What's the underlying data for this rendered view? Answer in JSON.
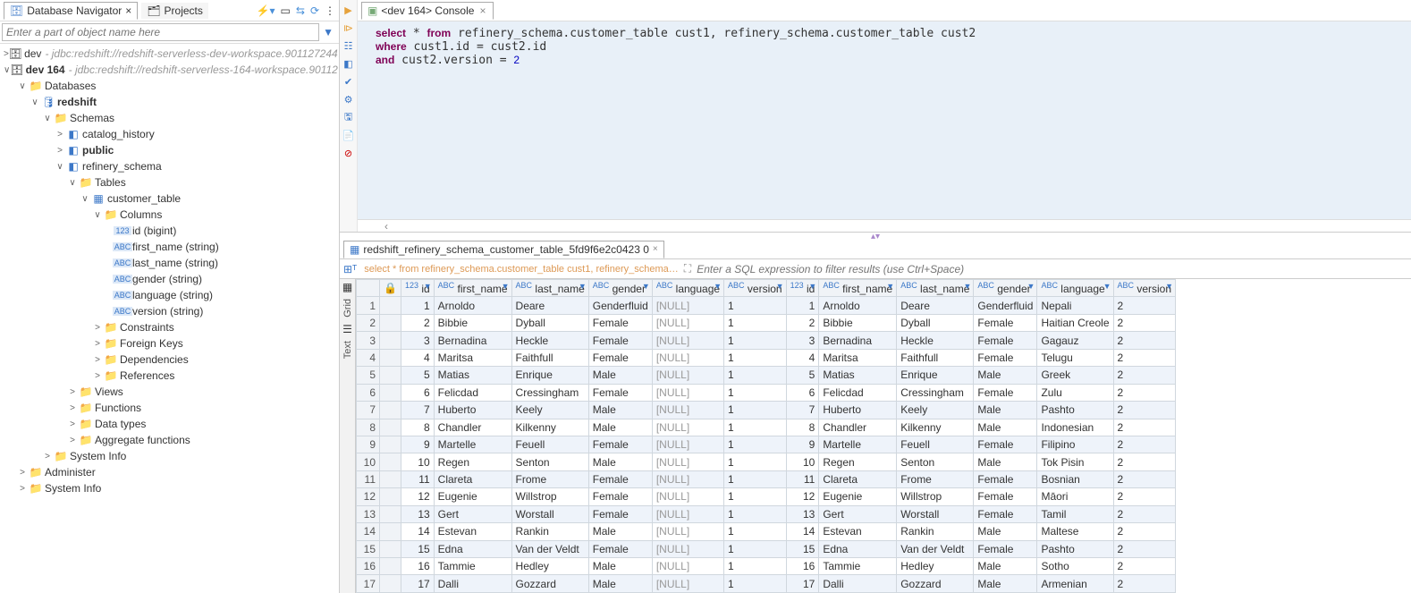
{
  "nav": {
    "tab1": "Database Navigator",
    "tab2": "Projects",
    "filter_placeholder": "Enter a part of object name here",
    "tree": [
      {
        "ind": 0,
        "tw": ">",
        "icon": "🗄",
        "lbl": "dev",
        "desc": " - jdbc:redshift://redshift-serverless-dev-workspace.901127244…",
        "name": "conn-dev"
      },
      {
        "ind": 0,
        "tw": "∨",
        "icon": "🗄",
        "lbl": "dev 164",
        "desc": " - jdbc:redshift://redshift-serverless-164-workspace.901127…",
        "bold": true,
        "name": "conn-dev164"
      },
      {
        "ind": 1,
        "tw": "∨",
        "icon": "📁",
        "cls": "i-folder",
        "lbl": "Databases",
        "name": "node-databases"
      },
      {
        "ind": 2,
        "tw": "∨",
        "icon": "🛢",
        "cls": "i-db",
        "lbl": "redshift",
        "bold": true,
        "name": "node-db-redshift"
      },
      {
        "ind": 3,
        "tw": "∨",
        "icon": "📁",
        "cls": "i-folder",
        "lbl": "Schemas",
        "name": "node-schemas"
      },
      {
        "ind": 4,
        "tw": ">",
        "icon": "◧",
        "cls": "i-schema",
        "lbl": "catalog_history",
        "name": "schema-catalog-history"
      },
      {
        "ind": 4,
        "tw": ">",
        "icon": "◧",
        "cls": "i-schema",
        "lbl": "public",
        "bold": true,
        "name": "schema-public"
      },
      {
        "ind": 4,
        "tw": "∨",
        "icon": "◧",
        "cls": "i-schema",
        "lbl": "refinery_schema",
        "name": "schema-refinery"
      },
      {
        "ind": 5,
        "tw": "∨",
        "icon": "📁",
        "cls": "i-folder",
        "lbl": "Tables",
        "name": "node-tables"
      },
      {
        "ind": 6,
        "tw": "∨",
        "icon": "▦",
        "cls": "i-table",
        "lbl": "customer_table",
        "name": "table-customer"
      },
      {
        "ind": 7,
        "tw": "∨",
        "icon": "📁",
        "cls": "i-folder",
        "lbl": "Columns",
        "name": "node-columns"
      },
      {
        "ind": 7,
        "tw": "",
        "icon": "▪",
        "cls": "i-col",
        "lbl": "id (bigint)",
        "pad": 1,
        "name": "col-id",
        "tp": "123"
      },
      {
        "ind": 7,
        "tw": "",
        "icon": "▪",
        "cls": "i-col",
        "lbl": "first_name (string)",
        "pad": 1,
        "name": "col-first-name",
        "tp": "ABC"
      },
      {
        "ind": 7,
        "tw": "",
        "icon": "▪",
        "cls": "i-col",
        "lbl": "last_name (string)",
        "pad": 1,
        "name": "col-last-name",
        "tp": "ABC"
      },
      {
        "ind": 7,
        "tw": "",
        "icon": "▪",
        "cls": "i-col",
        "lbl": "gender (string)",
        "pad": 1,
        "name": "col-gender",
        "tp": "ABC"
      },
      {
        "ind": 7,
        "tw": "",
        "icon": "▪",
        "cls": "i-col",
        "lbl": "language (string)",
        "pad": 1,
        "name": "col-language",
        "tp": "ABC"
      },
      {
        "ind": 7,
        "tw": "",
        "icon": "▪",
        "cls": "i-col",
        "lbl": "version (string)",
        "pad": 1,
        "name": "col-version",
        "tp": "ABC"
      },
      {
        "ind": 7,
        "tw": ">",
        "icon": "📁",
        "cls": "i-folder",
        "lbl": "Constraints",
        "name": "node-constraints"
      },
      {
        "ind": 7,
        "tw": ">",
        "icon": "📁",
        "cls": "i-folder",
        "lbl": "Foreign Keys",
        "name": "node-fks"
      },
      {
        "ind": 7,
        "tw": ">",
        "icon": "📁",
        "cls": "i-folder",
        "lbl": "Dependencies",
        "name": "node-deps"
      },
      {
        "ind": 7,
        "tw": ">",
        "icon": "📁",
        "cls": "i-folder",
        "lbl": "References",
        "name": "node-refs"
      },
      {
        "ind": 5,
        "tw": ">",
        "icon": "📁",
        "cls": "i-folder",
        "lbl": "Views",
        "name": "node-views"
      },
      {
        "ind": 5,
        "tw": ">",
        "icon": "📁",
        "cls": "i-folder",
        "lbl": "Functions",
        "name": "node-functions"
      },
      {
        "ind": 5,
        "tw": ">",
        "icon": "📁",
        "cls": "i-folder",
        "lbl": "Data types",
        "name": "node-datatypes"
      },
      {
        "ind": 5,
        "tw": ">",
        "icon": "📁",
        "cls": "i-folder",
        "lbl": "Aggregate functions",
        "name": "node-aggfunc"
      },
      {
        "ind": 3,
        "tw": ">",
        "icon": "📁",
        "cls": "i-folder",
        "lbl": "System Info",
        "name": "node-sysinfo1"
      },
      {
        "ind": 1,
        "tw": ">",
        "icon": "📁",
        "cls": "i-folder",
        "lbl": "Administer",
        "name": "node-administer"
      },
      {
        "ind": 1,
        "tw": ">",
        "icon": "📁",
        "cls": "i-folder",
        "lbl": "System Info",
        "name": "node-sysinfo2"
      }
    ]
  },
  "editor": {
    "tab": "<dev 164> Console",
    "sql_html": "<span class='kw'>select</span> * <span class='kw'>from</span> refinery_schema.customer_table cust1, refinery_schema.customer_table cust2\n<span class='kw'>where</span> cust1.id = cust2.id\n<span class='kw'>and</span> cust2.version = <span class='num'>2</span>"
  },
  "results": {
    "tab": "redshift_refinery_schema_customer_table_5fd9f6e2c0423 0",
    "sqlpreview": "select * from refinery_schema.customer_table cust1, refinery_schema…",
    "filter_placeholder": "Enter a SQL expression to filter results (use Ctrl+Space)",
    "side": {
      "grid": "Grid",
      "text": "Text"
    },
    "cols": [
      {
        "t": "123",
        "l": "id"
      },
      {
        "t": "ABC",
        "l": "first_name"
      },
      {
        "t": "ABC",
        "l": "last_name"
      },
      {
        "t": "ABC",
        "l": "gender"
      },
      {
        "t": "ABC",
        "l": "language"
      },
      {
        "t": "ABC",
        "l": "version"
      },
      {
        "t": "123",
        "l": "id"
      },
      {
        "t": "ABC",
        "l": "first_name"
      },
      {
        "t": "ABC",
        "l": "last_name"
      },
      {
        "t": "ABC",
        "l": "gender"
      },
      {
        "t": "ABC",
        "l": "language"
      },
      {
        "t": "ABC",
        "l": "version"
      }
    ],
    "rows": [
      [
        1,
        "Arnoldo",
        "Deare",
        "Genderfluid",
        "[NULL]",
        "1",
        1,
        "Arnoldo",
        "Deare",
        "Genderfluid",
        "Nepali",
        "2"
      ],
      [
        2,
        "Bibbie",
        "Dyball",
        "Female",
        "[NULL]",
        "1",
        2,
        "Bibbie",
        "Dyball",
        "Female",
        "Haitian Creole",
        "2"
      ],
      [
        3,
        "Bernadina",
        "Heckle",
        "Female",
        "[NULL]",
        "1",
        3,
        "Bernadina",
        "Heckle",
        "Female",
        "Gagauz",
        "2"
      ],
      [
        4,
        "Maritsa",
        "Faithfull",
        "Female",
        "[NULL]",
        "1",
        4,
        "Maritsa",
        "Faithfull",
        "Female",
        "Telugu",
        "2"
      ],
      [
        5,
        "Matias",
        "Enrique",
        "Male",
        "[NULL]",
        "1",
        5,
        "Matias",
        "Enrique",
        "Male",
        "Greek",
        "2"
      ],
      [
        6,
        "Felicdad",
        "Cressingham",
        "Female",
        "[NULL]",
        "1",
        6,
        "Felicdad",
        "Cressingham",
        "Female",
        "Zulu",
        "2"
      ],
      [
        7,
        "Huberto",
        "Keely",
        "Male",
        "[NULL]",
        "1",
        7,
        "Huberto",
        "Keely",
        "Male",
        "Pashto",
        "2"
      ],
      [
        8,
        "Chandler",
        "Kilkenny",
        "Male",
        "[NULL]",
        "1",
        8,
        "Chandler",
        "Kilkenny",
        "Male",
        "Indonesian",
        "2"
      ],
      [
        9,
        "Martelle",
        "Feuell",
        "Female",
        "[NULL]",
        "1",
        9,
        "Martelle",
        "Feuell",
        "Female",
        "Filipino",
        "2"
      ],
      [
        10,
        "Regen",
        "Senton",
        "Male",
        "[NULL]",
        "1",
        10,
        "Regen",
        "Senton",
        "Male",
        "Tok Pisin",
        "2"
      ],
      [
        11,
        "Clareta",
        "Frome",
        "Female",
        "[NULL]",
        "1",
        11,
        "Clareta",
        "Frome",
        "Female",
        "Bosnian",
        "2"
      ],
      [
        12,
        "Eugenie",
        "Willstrop",
        "Female",
        "[NULL]",
        "1",
        12,
        "Eugenie",
        "Willstrop",
        "Female",
        "Māori",
        "2"
      ],
      [
        13,
        "Gert",
        "Worstall",
        "Female",
        "[NULL]",
        "1",
        13,
        "Gert",
        "Worstall",
        "Female",
        "Tamil",
        "2"
      ],
      [
        14,
        "Estevan",
        "Rankin",
        "Male",
        "[NULL]",
        "1",
        14,
        "Estevan",
        "Rankin",
        "Male",
        "Maltese",
        "2"
      ],
      [
        15,
        "Edna",
        "Van der Veldt",
        "Female",
        "[NULL]",
        "1",
        15,
        "Edna",
        "Van der Veldt",
        "Female",
        "Pashto",
        "2"
      ],
      [
        16,
        "Tammie",
        "Hedley",
        "Male",
        "[NULL]",
        "1",
        16,
        "Tammie",
        "Hedley",
        "Male",
        "Sotho",
        "2"
      ],
      [
        17,
        "Dalli",
        "Gozzard",
        "Male",
        "[NULL]",
        "1",
        17,
        "Dalli",
        "Gozzard",
        "Male",
        "Armenian",
        "2"
      ]
    ]
  }
}
